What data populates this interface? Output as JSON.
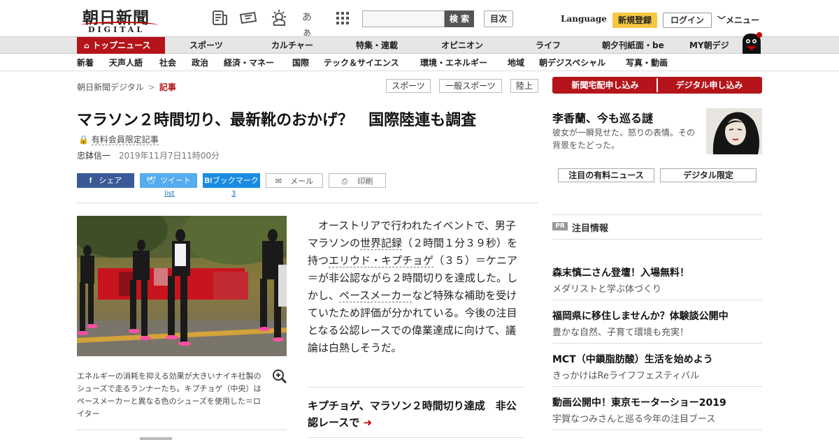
{
  "header": {
    "logo_text": "朝日新聞",
    "logo_sub": "DIGITAL",
    "search_button": "検 索",
    "toc_button": "目次",
    "language": "Language",
    "register": "新規登録",
    "login": "ログイン",
    "menu": "メニュー",
    "font_size_icon_text": "あぁ"
  },
  "nav_primary": [
    "トップニュース",
    "スポーツ",
    "カルチャー",
    "特集・連載",
    "オピニオン",
    "ライフ",
    "朝夕刊紙面・be",
    "MY朝デジ"
  ],
  "nav_secondary": [
    "新着",
    "天声人語",
    "社会",
    "政治",
    "経済・マネー",
    "国際",
    "テック＆サイエンス",
    "環境・エネルギー",
    "地域",
    "朝デジスペシャル",
    "写真・動画"
  ],
  "breadcrumb": {
    "root": "朝日新聞デジタル",
    "sep": ">",
    "current": "記事"
  },
  "tags": [
    "スポーツ",
    "一般スポーツ",
    "陸上"
  ],
  "article": {
    "title": "マラソン２時間切り、最新靴のおかげ？　国際陸連も調査",
    "paid_label": "有料会員限定記事",
    "author": "忠鉢信一",
    "date": "2019年11月7日11時00分",
    "photo_caption": "エネルギーの消耗を抑える効果が大きいナイキ社製のシューズで走るランナーたち。キプチョゲ（中央）はペースメーカーと異なる色のシューズを使用した＝ロイター",
    "body": {
      "p1": "オーストリアで行われたイベントで、男子マラソンの",
      "link1": "世界記録",
      "p2": "（２時間１分３９秒）を持つ",
      "link2": "エリウド・キプチョゲ",
      "p3": "（３５）＝ケニア＝が非公認ながら２時間切りを達成した。しかし、",
      "link3": "ペースメーカー",
      "p4": "など特殊な補助を受けていたため評価が分かれている。今後の注目となる公認レースでの偉業達成に向けて、議論は白熱しそうだ。"
    },
    "related": "キプチョゲ、マラソン２時間切り達成　非公認レースで",
    "related_arrow": "➜"
  },
  "share": {
    "facebook": "シェア",
    "twitter": "ツイート",
    "hatena": "ブックマーク",
    "hatena_logo": "B!",
    "mail": "メール",
    "print": "印刷",
    "twitter_count": "list",
    "hatena_count": "3"
  },
  "sidebar": {
    "subscribe_paper": "新聞宅配申し込み",
    "subscribe_digital": "デジタル申し込み",
    "feature_title": "李香蘭、今も巡る謎",
    "feature_desc": "彼女が一瞬見せた、怒りの表情。その背景をたどった。",
    "btn_paid_news": "注目の有料ニュース",
    "btn_digital_only": "デジタル限定",
    "pr_badge": "PR",
    "pr_heading": "注目情報",
    "ads": [
      {
        "title": "森末慎二さん登壇！入場無料！",
        "desc": "メダリストと学ぶ体づくり"
      },
      {
        "title": "福岡県に移住しませんか？体験談公開中",
        "desc": "豊かな自然、子育て環境も充実！"
      },
      {
        "title": "MCT（中鎖脂肪酸）生活を始めよう",
        "desc": "きっかけはReライフフェスティバル"
      },
      {
        "title": "動画公開中！東京モーターショー2019",
        "desc": "宇賀なつみさんと巡る今年の注目ブース"
      }
    ]
  },
  "colors": {
    "brand_red": "#b4141a",
    "facebook": "#3b5998",
    "twitter": "#55acee",
    "hatena": "#1a8be2",
    "register_yellow": "#f5c842"
  }
}
